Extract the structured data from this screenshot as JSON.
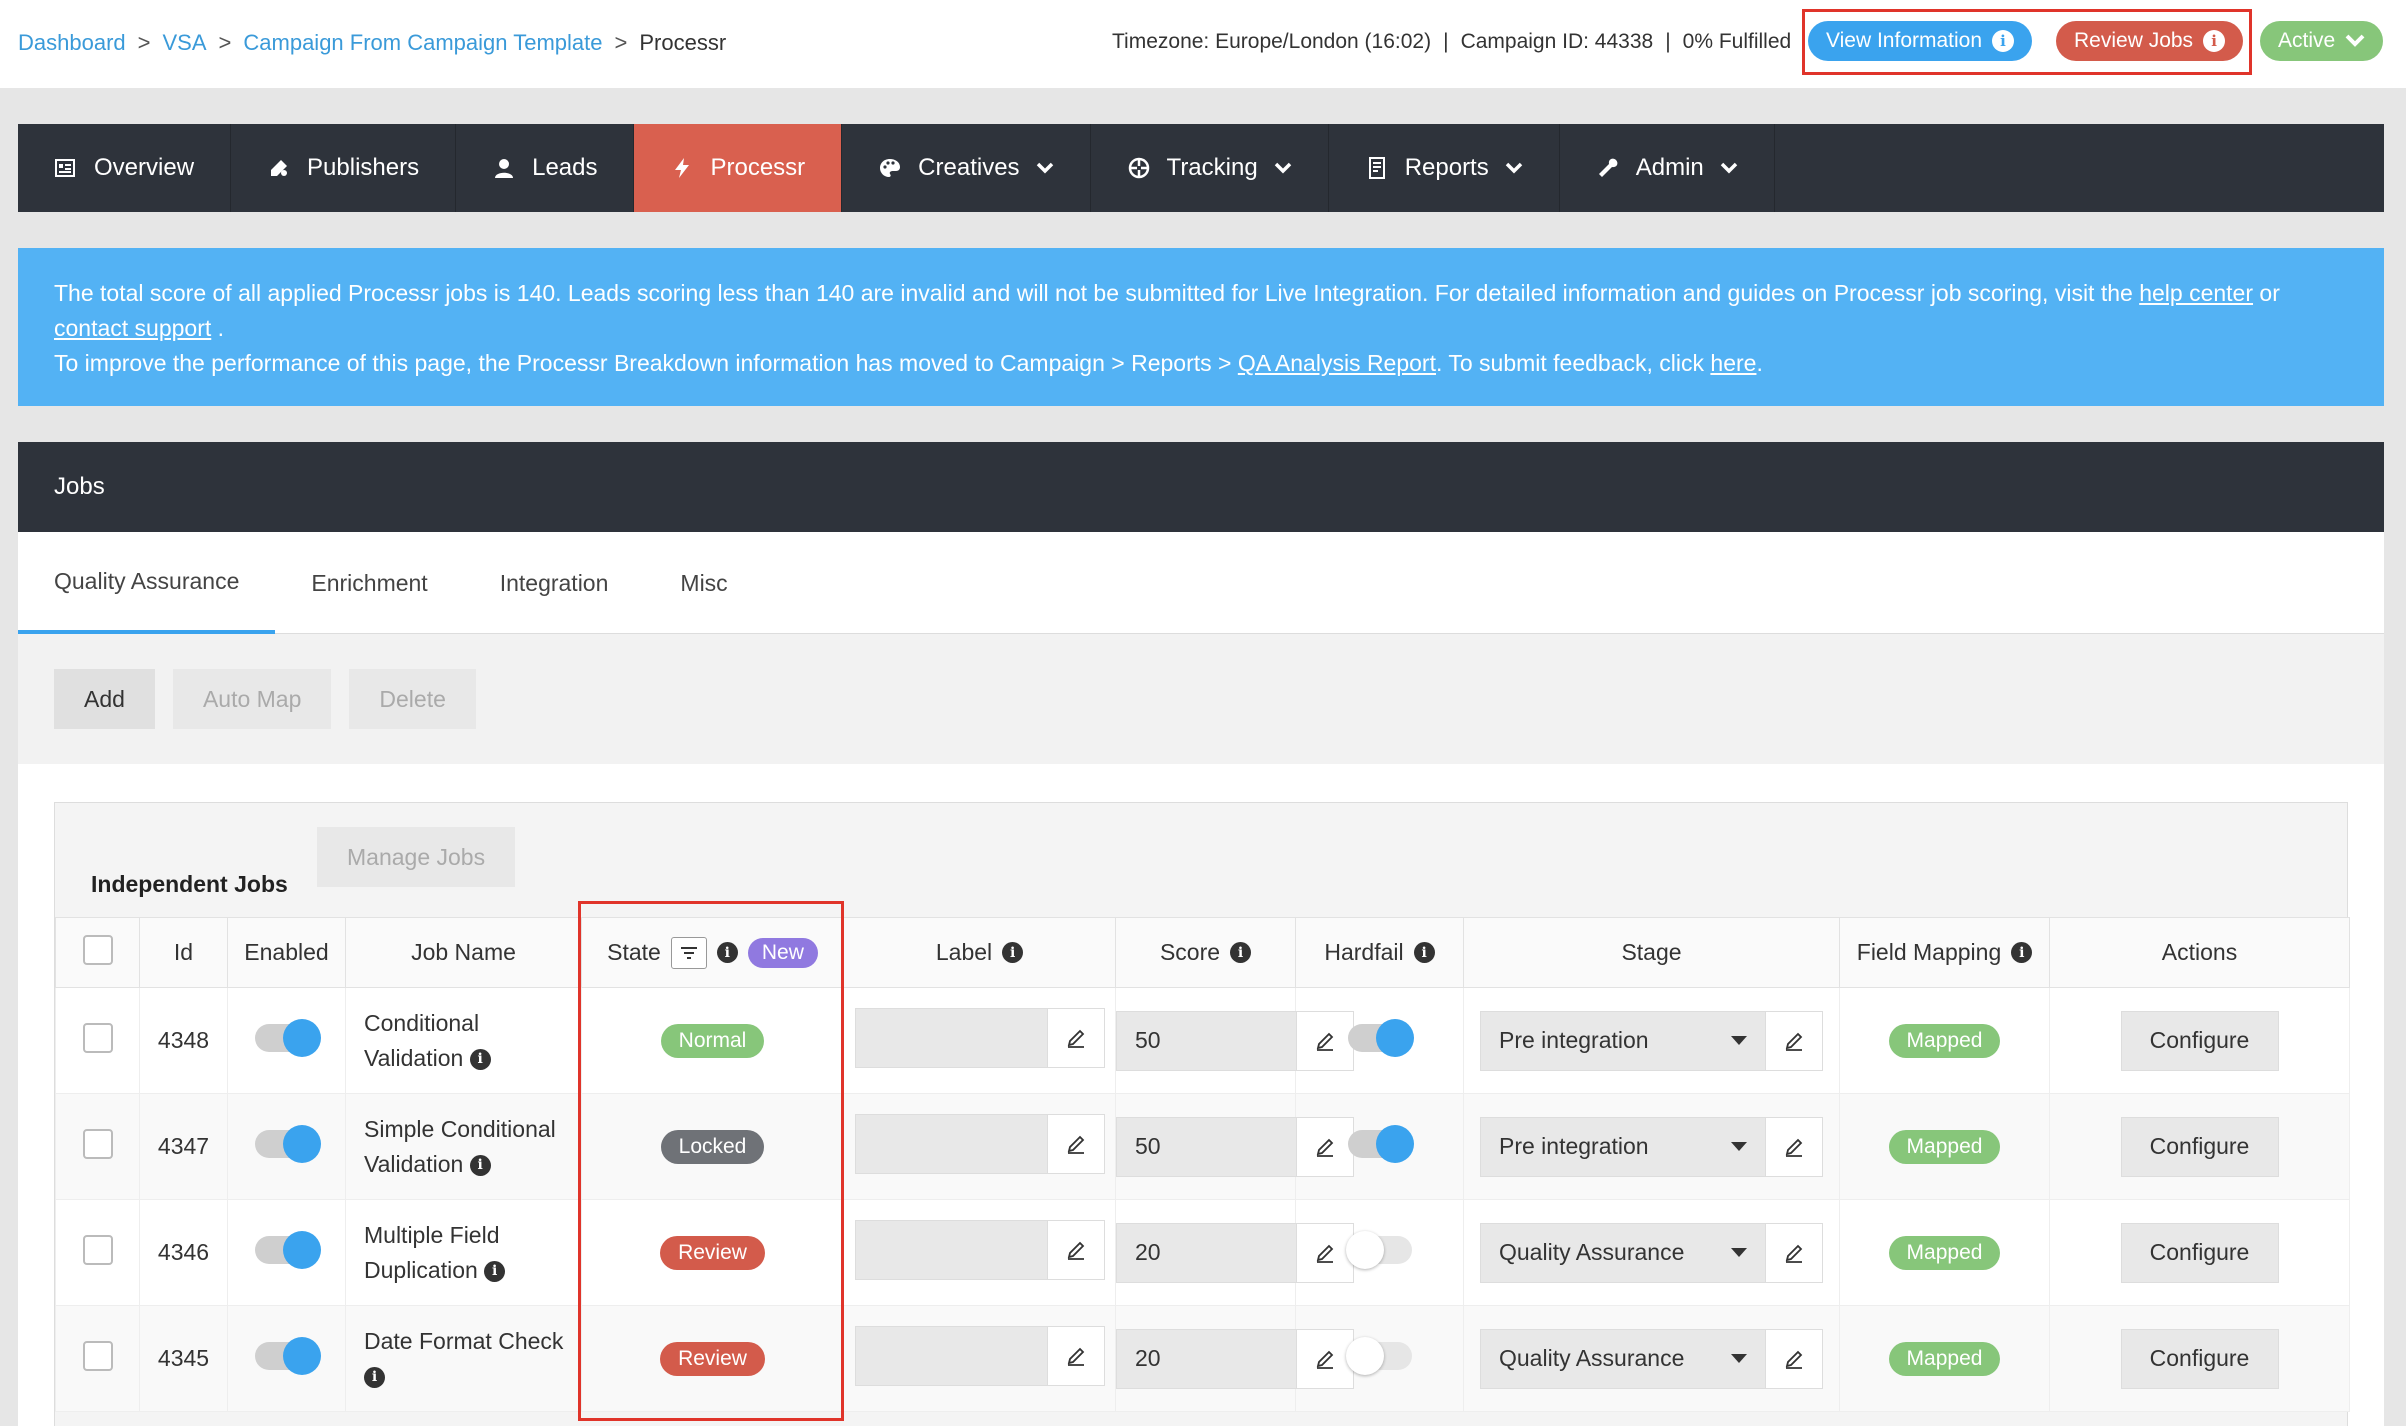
{
  "breadcrumb": {
    "items": [
      "Dashboard",
      "VSA",
      "Campaign From Campaign Template"
    ],
    "separator": ">",
    "current": "Processr"
  },
  "header": {
    "timezone": "Timezone: Europe/London (16:02)",
    "campaign_id": "Campaign ID: 44338",
    "fulfilled": "0% Fulfilled",
    "meta_separator": "|",
    "view_info_label": "View Information",
    "review_jobs_label": "Review Jobs",
    "status_label": "Active"
  },
  "nav": {
    "overview": "Overview",
    "publishers": "Publishers",
    "leads": "Leads",
    "processr": "Processr",
    "creatives": "Creatives",
    "tracking": "Tracking",
    "reports": "Reports",
    "admin": "Admin"
  },
  "banner": {
    "line1_prefix": "The total score of all applied Processr jobs is 140. Leads scoring less than 140 are invalid and will not be submitted for Live Integration. For detailed information and guides on Processr job scoring, visit the ",
    "help_center": "help center",
    "or": " or",
    "contact_support": "contact support",
    "line2_end": " .",
    "line3_prefix": "To improve the performance of this page, the Processr Breakdown information has moved to Campaign > Reports > ",
    "qa_report": "QA Analysis Report",
    "line3_mid": ". To submit feedback, click ",
    "here": "here",
    "line3_end": "."
  },
  "jobs": {
    "title": "Jobs",
    "tabs": [
      "Quality Assurance",
      "Enrichment",
      "Integration",
      "Misc"
    ],
    "toolbar": {
      "add": "Add",
      "auto_map": "Auto Map",
      "delete": "Delete"
    },
    "independent_title": "Independent Jobs",
    "manage_jobs": "Manage Jobs",
    "columns": {
      "id": "Id",
      "enabled": "Enabled",
      "job_name": "Job Name",
      "state": "State",
      "new_badge": "New",
      "label": "Label",
      "score": "Score",
      "hardfail": "Hardfail",
      "stage": "Stage",
      "field_mapping": "Field Mapping",
      "actions": "Actions"
    },
    "rows": [
      {
        "id": "4348",
        "name_line1": "Conditional",
        "name_line2": "Validation",
        "state": "Normal",
        "score": "50",
        "stage": "Pre integration",
        "mapping": "Mapped",
        "action": "Configure"
      },
      {
        "id": "4347",
        "name_line1": "Simple Conditional",
        "name_line2": "Validation",
        "state": "Locked",
        "score": "50",
        "stage": "Pre integration",
        "mapping": "Mapped",
        "action": "Configure"
      },
      {
        "id": "4346",
        "name_line1": "Multiple Field",
        "name_line2": "Duplication",
        "state": "Review",
        "score": "20",
        "stage": "Quality Assurance",
        "mapping": "Mapped",
        "action": "Configure"
      },
      {
        "id": "4345",
        "name_line1": "Date Format Check",
        "name_line2": "",
        "state": "Review",
        "score": "20",
        "stage": "Quality Assurance",
        "mapping": "Mapped",
        "action": "Configure"
      }
    ]
  },
  "colors": {
    "accent_blue": "#3aa3ee",
    "active_nav": "#d9604f",
    "banner": "#53b2f4",
    "highlight": "#e0342a"
  }
}
